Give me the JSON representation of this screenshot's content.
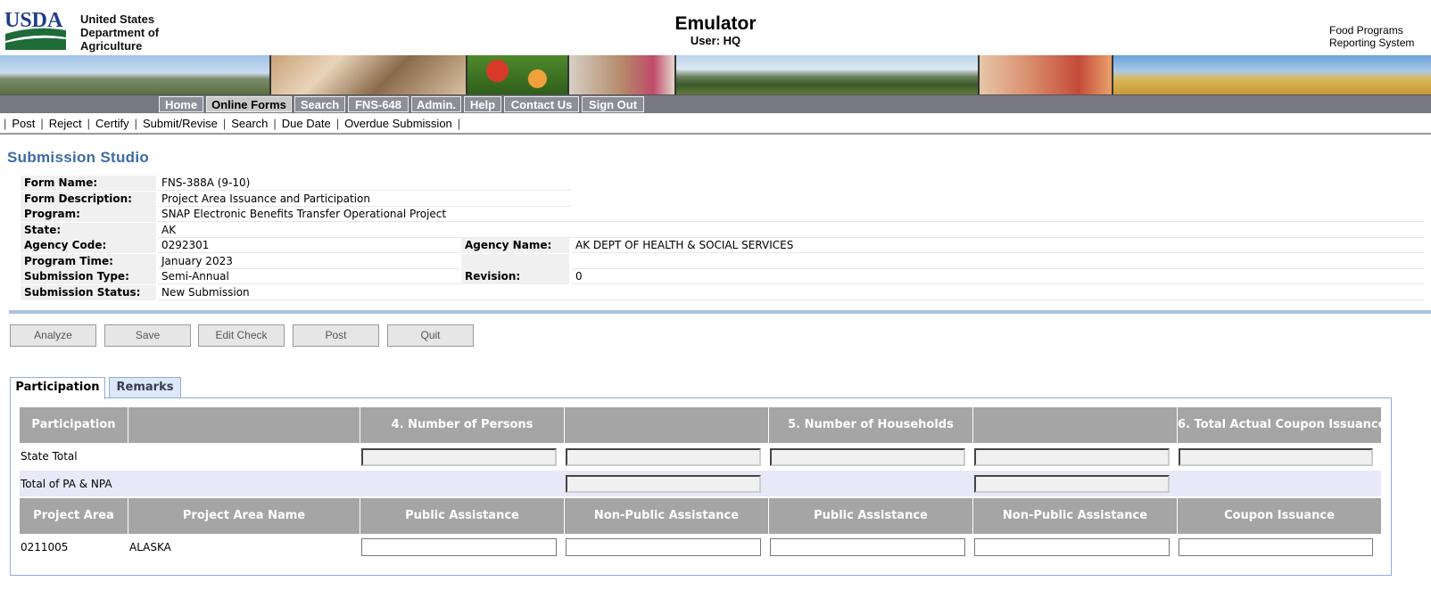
{
  "header": {
    "logo_text": "USDA",
    "department": [
      "United States",
      "Department of",
      "Agriculture"
    ],
    "app_title": "Emulator",
    "user_line": "User: HQ",
    "system_name": [
      "Food Programs",
      "Reporting System"
    ]
  },
  "main_nav": [
    "Home",
    "Online Forms",
    "Search",
    "FNS-648",
    "Admin.",
    "Help",
    "Contact Us",
    "Sign Out"
  ],
  "sub_nav": [
    "Post",
    "Reject",
    "Certify",
    "Submit/Revise",
    "Search",
    "Due Date",
    "Overdue Submission"
  ],
  "page_title": "Submission Studio",
  "info": {
    "form_name_label": "Form Name:",
    "form_name": "FNS-388A (9-10)",
    "form_desc_label": "Form Description:",
    "form_desc": "Project Area Issuance and Participation",
    "program_label": "Program:",
    "program": "SNAP Electronic Benefits Transfer Operational Project",
    "state_label": "State:",
    "state": "AK",
    "agency_code_label": "Agency Code:",
    "agency_code": "0292301",
    "agency_name_label": "Agency Name:",
    "agency_name": "AK DEPT OF HEALTH & SOCIAL SERVICES",
    "program_time_label": "Program Time:",
    "program_time": "January 2023",
    "submission_type_label": "Submission Type:",
    "submission_type": "Semi-Annual",
    "revision_label": "Revision:",
    "revision": "0",
    "submission_status_label": "Submission Status:",
    "submission_status": "New Submission"
  },
  "actions": [
    "Analyze",
    "Save",
    "Edit Check",
    "Post",
    "Quit"
  ],
  "tabs": [
    "Participation",
    "Remarks"
  ],
  "grid": {
    "top_headers": [
      "Participation",
      "",
      "4. Number of Persons",
      "",
      "5. Number of Households",
      "",
      "6. Total Actual Coupon Issuance"
    ],
    "state_total_label": "State Total",
    "pa_npa_label": "Total of PA & NPA",
    "sub_headers": [
      "Project Area",
      "Project Area Name",
      "Public Assistance",
      "Non-Public Assistance",
      "Public Assistance",
      "Non-Public Assistance",
      "Coupon Issuance"
    ],
    "rows": [
      {
        "project_area": "0211005",
        "project_area_name": "ALASKA"
      }
    ]
  }
}
